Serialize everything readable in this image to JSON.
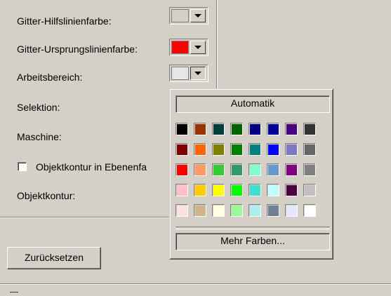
{
  "labels": {
    "grid_help_color": "Gitter-Hilfslinienfarbe:",
    "grid_origin_color": "Gitter-Ursprungslinienfarbe:",
    "work_area": "Arbeitsbereich:",
    "selection": "Selektion:",
    "machine": "Maschine:",
    "object_contour_checkbox": "Objektkontur in Ebenenfa",
    "object_contour": "Objektkontur:"
  },
  "combos": {
    "grid_help_color": "#d4d0c8",
    "grid_origin_color": "#ff0000",
    "work_area": "#e6e6e6"
  },
  "buttons": {
    "reset": "Zurücksetzen"
  },
  "color_popup": {
    "automatic_label": "Automatik",
    "more_colors_label": "Mehr Farben...",
    "colors": [
      [
        "#000000",
        "#993300",
        "#003c3c",
        "#006400",
        "#000080",
        "#000099",
        "#4b0082",
        "#333333"
      ],
      [
        "#800000",
        "#ff6600",
        "#808000",
        "#008000",
        "#008080",
        "#0000ff",
        "#7a7ac2",
        "#666666"
      ],
      [
        "#ff0000",
        "#ff9966",
        "#33cc33",
        "#339966",
        "#80ffcc",
        "#6699cc",
        "#800080",
        "#808080"
      ],
      [
        "#ffc0cb",
        "#ffcc00",
        "#ffff00",
        "#00ff00",
        "#40e0d0",
        "#c0ffff",
        "#4b0040",
        "#c0c0c0"
      ],
      [
        "#ffe0e0",
        "#d2b48c",
        "#ffffe0",
        "#98fb98",
        "#afeeee",
        "#708090",
        "#e6e6fa",
        "#ffffff"
      ]
    ]
  }
}
